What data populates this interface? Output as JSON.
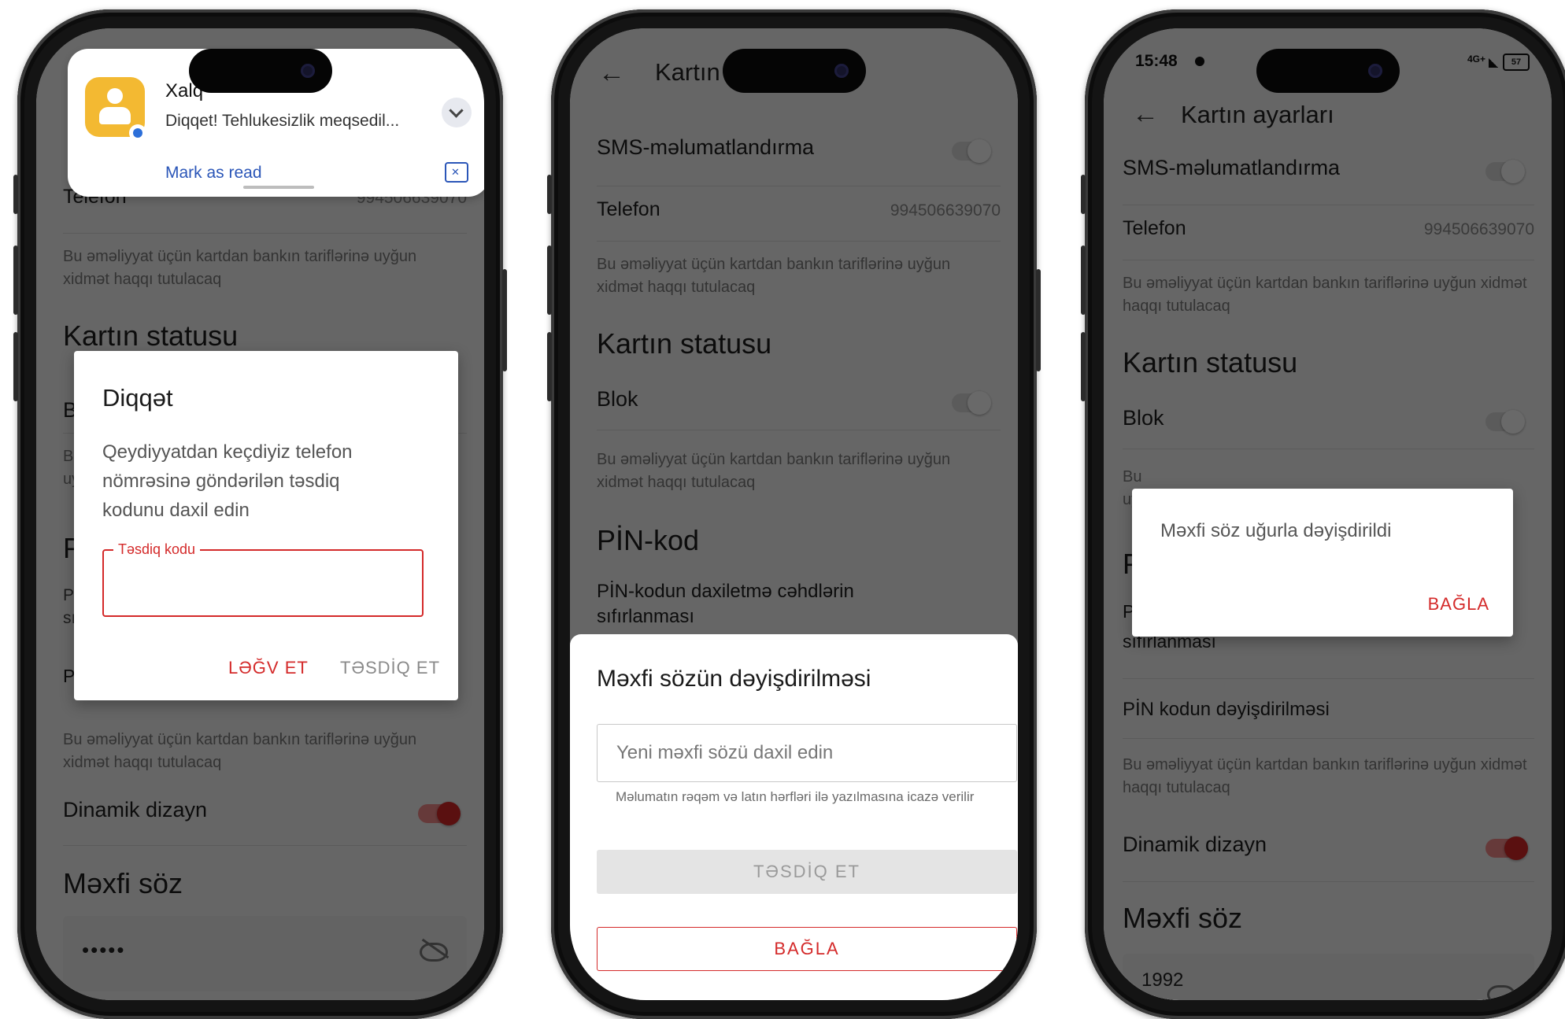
{
  "phone1": {
    "notification": {
      "app_name": "Xalq",
      "message": "Diqqet! Tehlukesizlik meqsedil...",
      "action": "Mark as read"
    },
    "phone_label": "Telefon",
    "phone_value": "994506639070",
    "note": "Bu əməliyyat üçün kartdan bankın tariflərinə uyğun xidmət haqqı tutulacaq",
    "card_status_heading": "Kartın statusu",
    "dialog": {
      "title": "Diqqət",
      "message": "Qeydiyyatdan keçdiyiz telefon nömrəsinə göndərilən təsdiq kodunu daxil edin",
      "field_label": "Təsdiq kodu",
      "field_value": "",
      "cancel_label": "LƏĞV ET",
      "confirm_label": "TƏSDİQ ET"
    },
    "dynamic_design_label": "Dinamik dizayn",
    "password_heading": "Məxfi söz",
    "password_value": "•••••"
  },
  "phone2": {
    "title": "Kartın",
    "sms_label": "SMS-məlumatlandırma",
    "phone_label": "Telefon",
    "phone_value": "994506639070",
    "note": "Bu əməliyyat üçün kartdan bankın tariflərinə uyğun xidmət haqqı tutulacaq",
    "card_status_heading": "Kartın statusu",
    "block_label": "Blok",
    "pin_heading": "PİN-kod",
    "pin_reset_label": "PİN-kodun daxiletmə cəhdlərin sıfırlanması",
    "sheet": {
      "title": "Məxfi sözün dəyişdirilməsi",
      "input_placeholder": "Yeni məxfi sözü daxil edin",
      "hint": "Məlumatın rəqəm və latın hərfləri ilə yazılmasına icazə verilir",
      "confirm_label": "TƏSDİQ ET",
      "close_label": "BAĞLA"
    }
  },
  "phone3": {
    "time": "15:48",
    "network": "4G+",
    "battery": "57",
    "title": "Kartın ayarları",
    "sms_label": "SMS-məlumatlandırma",
    "phone_label": "Telefon",
    "phone_value": "994506639070",
    "note": "Bu əməliyyat üçün kartdan bankın tariflərinə uyğun xidmət haqqı tutulacaq",
    "card_status_heading": "Kartın statusu",
    "block_label": "Blok",
    "pin_reset_tail": "sıfırlanması",
    "pin_change_label": "PİN kodun dəyişdirilməsi",
    "dynamic_design_label": "Dinamik dizayn",
    "password_heading": "Məxfi söz",
    "password_value": "1992",
    "dialog": {
      "message": "Məxfi söz uğurla dəyişdirildi",
      "close_label": "BAĞLA"
    }
  },
  "colors": {
    "accent": "#d42a2a",
    "notification_icon": "#f3b932",
    "scrim": "rgba(0,0,0,0.58)"
  }
}
